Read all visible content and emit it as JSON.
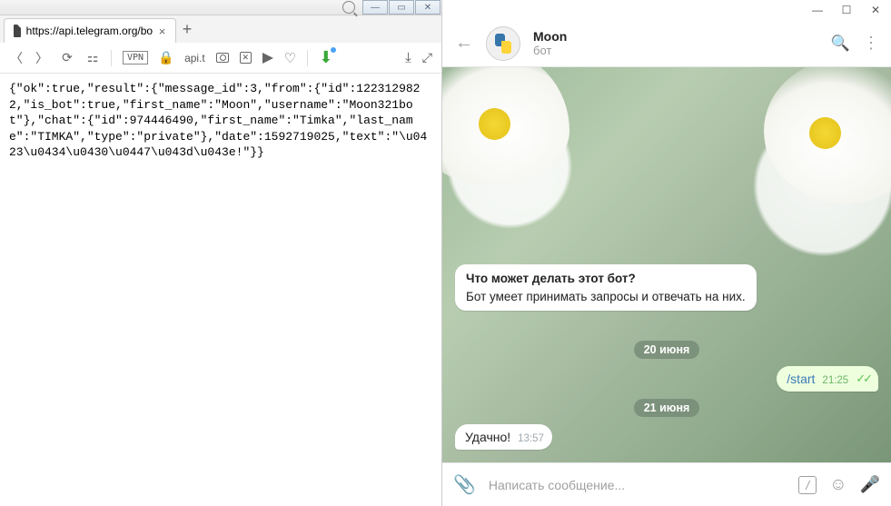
{
  "browser": {
    "tab": {
      "title": "https://api.telegram.org/bo"
    },
    "toolbar": {
      "vpn": "VPN",
      "addr": "api.t"
    },
    "response": "{\"ok\":true,\"result\":{\"message_id\":3,\"from\":{\"id\":1223129822,\"is_bot\":true,\"first_name\":\"Moon\",\"username\":\"Moon321bot\"},\"chat\":{\"id\":974446490,\"first_name\":\"Timka\",\"last_name\":\"TIMKA\",\"type\":\"private\"},\"date\":1592719025,\"text\":\"\\u0423\\u0434\\u0430\\u0447\\u043d\\u043e!\"}}"
  },
  "telegram": {
    "header": {
      "name": "Moon",
      "subtitle": "бот"
    },
    "info": {
      "question": "Что может делать этот бот?",
      "answer": "Бот умеет принимать запросы и отвечать на них."
    },
    "date1": "20 июня",
    "msg_out": {
      "text": "/start",
      "time": "21:25",
      "ticks": "✓✓"
    },
    "date2": "21 июня",
    "msg_in": {
      "text": "Удачно!",
      "time": "13:57"
    },
    "input": {
      "placeholder": "Написать сообщение..."
    }
  }
}
